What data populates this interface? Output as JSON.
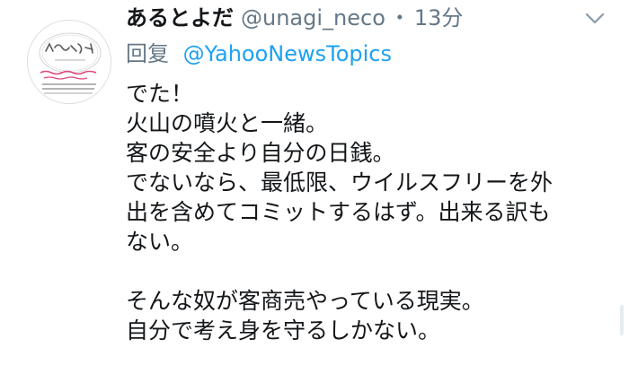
{
  "tweet": {
    "display_name": "あるとよだ",
    "handle": "@unagi_neco",
    "separator": "・",
    "time": "13分",
    "reply_label": "回复",
    "reply_to": "@YahooNewsTopics",
    "lines": [
      "でた！",
      "火山の噴火と一緒。",
      "客の安全より自分の日銭。",
      "でないなら、最低限、ウイルスフリーを外",
      "出を含めてコミットするはず。出来る訳も",
      "ない。",
      "",
      "そんな奴が客商売やっている現実。",
      "自分で考え身を守るしかない。"
    ],
    "caret_icon": "chevron-down-icon"
  },
  "colors": {
    "name": "#14171a",
    "secondary": "#657786",
    "link": "#1da1f2"
  }
}
